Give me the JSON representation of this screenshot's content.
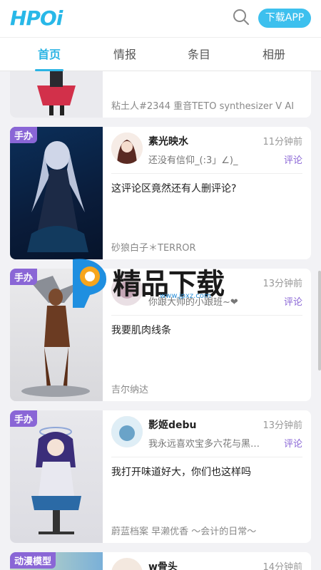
{
  "header": {
    "logo": "HPOi",
    "download_button": "下载APP"
  },
  "tabs": [
    {
      "label": "首页",
      "active": true
    },
    {
      "label": "情报",
      "active": false
    },
    {
      "label": "条目",
      "active": false
    },
    {
      "label": "相册",
      "active": false
    }
  ],
  "feed": [
    {
      "product": "粘土人#2344 重音TETO synthesizer V AI"
    },
    {
      "badge": "手办",
      "user": "素光映水",
      "time": "11分钟前",
      "snippet": "还没有信仰_(:3」∠)_",
      "reply_label": "评论",
      "comment": "这评论区竟然还有人删评论?",
      "product": "砂狼白子＊TERROR"
    },
    {
      "badge": "手办",
      "user": "",
      "time": "13分钟前",
      "snippet": "你跟大帅的小跟班~❤",
      "reply_label": "评论",
      "comment": "我要肌肉线条",
      "product": "吉尔纳达"
    },
    {
      "badge": "手办",
      "user": "影姬debu",
      "time": "13分钟前",
      "snippet": "我永远喜欢宝多六花与黑…",
      "reply_label": "评论",
      "comment": "我打开味道好大，你们也这样吗",
      "product": "蔚蓝档案 早濑优香 〜会计的日常〜"
    },
    {
      "badge": "动漫模型",
      "user": "w骨头",
      "time": "14分钟前"
    }
  ],
  "watermark": {
    "text": "精品下载",
    "url": "www.jpxz.com"
  },
  "colors": {
    "brand": "#28b8e8",
    "accent_purple": "#8a66d6"
  }
}
